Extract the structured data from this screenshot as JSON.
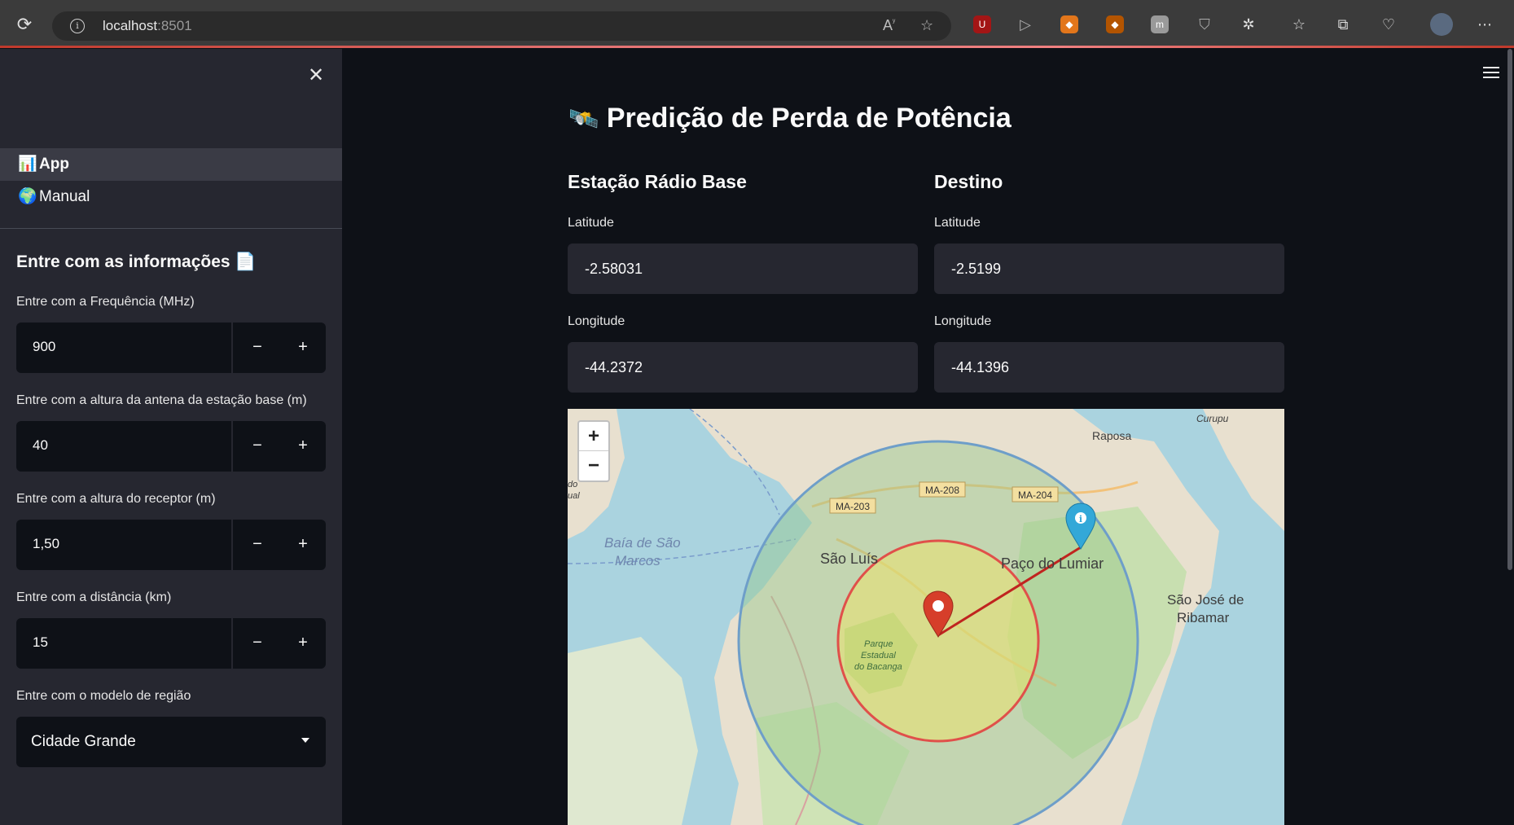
{
  "browser": {
    "url_host": "localhost",
    "url_port": ":8501"
  },
  "sidebar": {
    "nav": [
      {
        "icon": "📊",
        "label": "App",
        "active": true
      },
      {
        "icon": "🌍",
        "label": "Manual",
        "active": false
      }
    ],
    "title": "Entre com as informações 📄",
    "fields": {
      "frequency": {
        "label": "Entre com a Frequência (MHz)",
        "value": "900"
      },
      "base_height": {
        "label": "Entre com a altura da antena da estação base (m)",
        "value": "40"
      },
      "receiver_height": {
        "label": "Entre com a altura do receptor (m)",
        "value": "1,50"
      },
      "distance": {
        "label": "Entre com a distância (km)",
        "value": "15"
      }
    },
    "region": {
      "label": "Entre com o modelo de região",
      "value": "Cidade Grande"
    },
    "minus": "−",
    "plus": "+"
  },
  "main": {
    "title": "Predição de Perda de Potência",
    "title_icon": "🛰️",
    "base_station": {
      "heading": "Estação Rádio Base",
      "lat_label": "Latitude",
      "lat_value": "-2.58031",
      "lon_label": "Longitude",
      "lon_value": "-44.2372"
    },
    "destination": {
      "heading": "Destino",
      "lat_label": "Latitude",
      "lat_value": "-2.5199",
      "lon_label": "Longitude",
      "lon_value": "-44.1396"
    },
    "map": {
      "zoom_in": "+",
      "zoom_out": "−",
      "labels": {
        "bay": "Baía de São",
        "bay2": "Marcos",
        "city": "São Luís",
        "paco": "Paço do Lumiar",
        "sjr1": "São José de",
        "sjr2": "Ribamar",
        "raposa": "Raposa",
        "curupu": "Curupu",
        "park1": "Parque",
        "park2": "Estadual",
        "park3": "do Bacanga",
        "ma203": "MA-203",
        "ma208": "MA-208",
        "ma204": "MA-204",
        "edge1": "do",
        "edge2": "ual"
      }
    }
  }
}
